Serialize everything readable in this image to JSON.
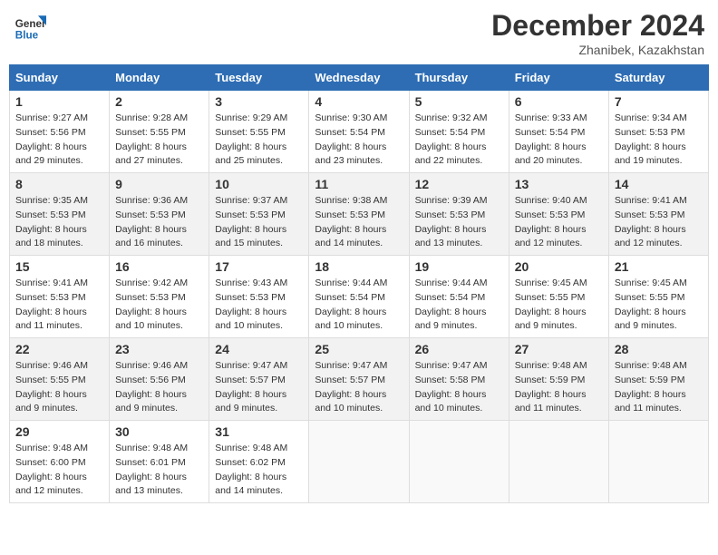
{
  "header": {
    "logo_line1": "General",
    "logo_line2": "Blue",
    "month_title": "December 2024",
    "location": "Zhanibek, Kazakhstan"
  },
  "weekdays": [
    "Sunday",
    "Monday",
    "Tuesday",
    "Wednesday",
    "Thursday",
    "Friday",
    "Saturday"
  ],
  "weeks": [
    [
      {
        "day": "1",
        "sunrise": "9:27 AM",
        "sunset": "5:56 PM",
        "daylight": "8 hours and 29 minutes."
      },
      {
        "day": "2",
        "sunrise": "9:28 AM",
        "sunset": "5:55 PM",
        "daylight": "8 hours and 27 minutes."
      },
      {
        "day": "3",
        "sunrise": "9:29 AM",
        "sunset": "5:55 PM",
        "daylight": "8 hours and 25 minutes."
      },
      {
        "day": "4",
        "sunrise": "9:30 AM",
        "sunset": "5:54 PM",
        "daylight": "8 hours and 23 minutes."
      },
      {
        "day": "5",
        "sunrise": "9:32 AM",
        "sunset": "5:54 PM",
        "daylight": "8 hours and 22 minutes."
      },
      {
        "day": "6",
        "sunrise": "9:33 AM",
        "sunset": "5:54 PM",
        "daylight": "8 hours and 20 minutes."
      },
      {
        "day": "7",
        "sunrise": "9:34 AM",
        "sunset": "5:53 PM",
        "daylight": "8 hours and 19 minutes."
      }
    ],
    [
      {
        "day": "8",
        "sunrise": "9:35 AM",
        "sunset": "5:53 PM",
        "daylight": "8 hours and 18 minutes."
      },
      {
        "day": "9",
        "sunrise": "9:36 AM",
        "sunset": "5:53 PM",
        "daylight": "8 hours and 16 minutes."
      },
      {
        "day": "10",
        "sunrise": "9:37 AM",
        "sunset": "5:53 PM",
        "daylight": "8 hours and 15 minutes."
      },
      {
        "day": "11",
        "sunrise": "9:38 AM",
        "sunset": "5:53 PM",
        "daylight": "8 hours and 14 minutes."
      },
      {
        "day": "12",
        "sunrise": "9:39 AM",
        "sunset": "5:53 PM",
        "daylight": "8 hours and 13 minutes."
      },
      {
        "day": "13",
        "sunrise": "9:40 AM",
        "sunset": "5:53 PM",
        "daylight": "8 hours and 12 minutes."
      },
      {
        "day": "14",
        "sunrise": "9:41 AM",
        "sunset": "5:53 PM",
        "daylight": "8 hours and 12 minutes."
      }
    ],
    [
      {
        "day": "15",
        "sunrise": "9:41 AM",
        "sunset": "5:53 PM",
        "daylight": "8 hours and 11 minutes."
      },
      {
        "day": "16",
        "sunrise": "9:42 AM",
        "sunset": "5:53 PM",
        "daylight": "8 hours and 10 minutes."
      },
      {
        "day": "17",
        "sunrise": "9:43 AM",
        "sunset": "5:53 PM",
        "daylight": "8 hours and 10 minutes."
      },
      {
        "day": "18",
        "sunrise": "9:44 AM",
        "sunset": "5:54 PM",
        "daylight": "8 hours and 10 minutes."
      },
      {
        "day": "19",
        "sunrise": "9:44 AM",
        "sunset": "5:54 PM",
        "daylight": "8 hours and 9 minutes."
      },
      {
        "day": "20",
        "sunrise": "9:45 AM",
        "sunset": "5:55 PM",
        "daylight": "8 hours and 9 minutes."
      },
      {
        "day": "21",
        "sunrise": "9:45 AM",
        "sunset": "5:55 PM",
        "daylight": "8 hours and 9 minutes."
      }
    ],
    [
      {
        "day": "22",
        "sunrise": "9:46 AM",
        "sunset": "5:55 PM",
        "daylight": "8 hours and 9 minutes."
      },
      {
        "day": "23",
        "sunrise": "9:46 AM",
        "sunset": "5:56 PM",
        "daylight": "8 hours and 9 minutes."
      },
      {
        "day": "24",
        "sunrise": "9:47 AM",
        "sunset": "5:57 PM",
        "daylight": "8 hours and 9 minutes."
      },
      {
        "day": "25",
        "sunrise": "9:47 AM",
        "sunset": "5:57 PM",
        "daylight": "8 hours and 10 minutes."
      },
      {
        "day": "26",
        "sunrise": "9:47 AM",
        "sunset": "5:58 PM",
        "daylight": "8 hours and 10 minutes."
      },
      {
        "day": "27",
        "sunrise": "9:48 AM",
        "sunset": "5:59 PM",
        "daylight": "8 hours and 11 minutes."
      },
      {
        "day": "28",
        "sunrise": "9:48 AM",
        "sunset": "5:59 PM",
        "daylight": "8 hours and 11 minutes."
      }
    ],
    [
      {
        "day": "29",
        "sunrise": "9:48 AM",
        "sunset": "6:00 PM",
        "daylight": "8 hours and 12 minutes."
      },
      {
        "day": "30",
        "sunrise": "9:48 AM",
        "sunset": "6:01 PM",
        "daylight": "8 hours and 13 minutes."
      },
      {
        "day": "31",
        "sunrise": "9:48 AM",
        "sunset": "6:02 PM",
        "daylight": "8 hours and 14 minutes."
      },
      null,
      null,
      null,
      null
    ]
  ],
  "labels": {
    "sunrise": "Sunrise:",
    "sunset": "Sunset:",
    "daylight": "Daylight:"
  }
}
